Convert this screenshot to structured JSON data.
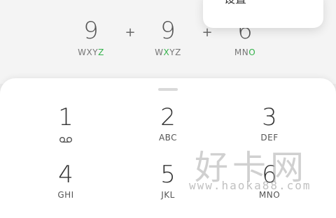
{
  "menu": {
    "settings_label": "设置"
  },
  "expression": {
    "terms": [
      {
        "digit": "9",
        "letters_pre": "WXY",
        "letters_hl": "Z",
        "letters_post": ""
      },
      {
        "digit": "9",
        "letters_pre": "W",
        "letters_hl": "X",
        "letters_post": "YZ"
      },
      {
        "digit": "6",
        "letters_pre": "MN",
        "letters_hl": "O",
        "letters_post": ""
      }
    ],
    "operator": "+"
  },
  "keypad": {
    "keys": [
      {
        "digit": "1",
        "letters": ""
      },
      {
        "digit": "2",
        "letters": "ABC"
      },
      {
        "digit": "3",
        "letters": "DEF"
      },
      {
        "digit": "4",
        "letters": "GHI"
      },
      {
        "digit": "5",
        "letters": "JKL"
      },
      {
        "digit": "6",
        "letters": "MNO"
      }
    ],
    "key1_icon": "voicemail-icon"
  },
  "watermark": {
    "brand": "好卡网",
    "url": "www.haoka88.com"
  },
  "colors": {
    "highlight": "#33b24a",
    "background": "#f4f4f4",
    "sheet": "#ffffff"
  }
}
